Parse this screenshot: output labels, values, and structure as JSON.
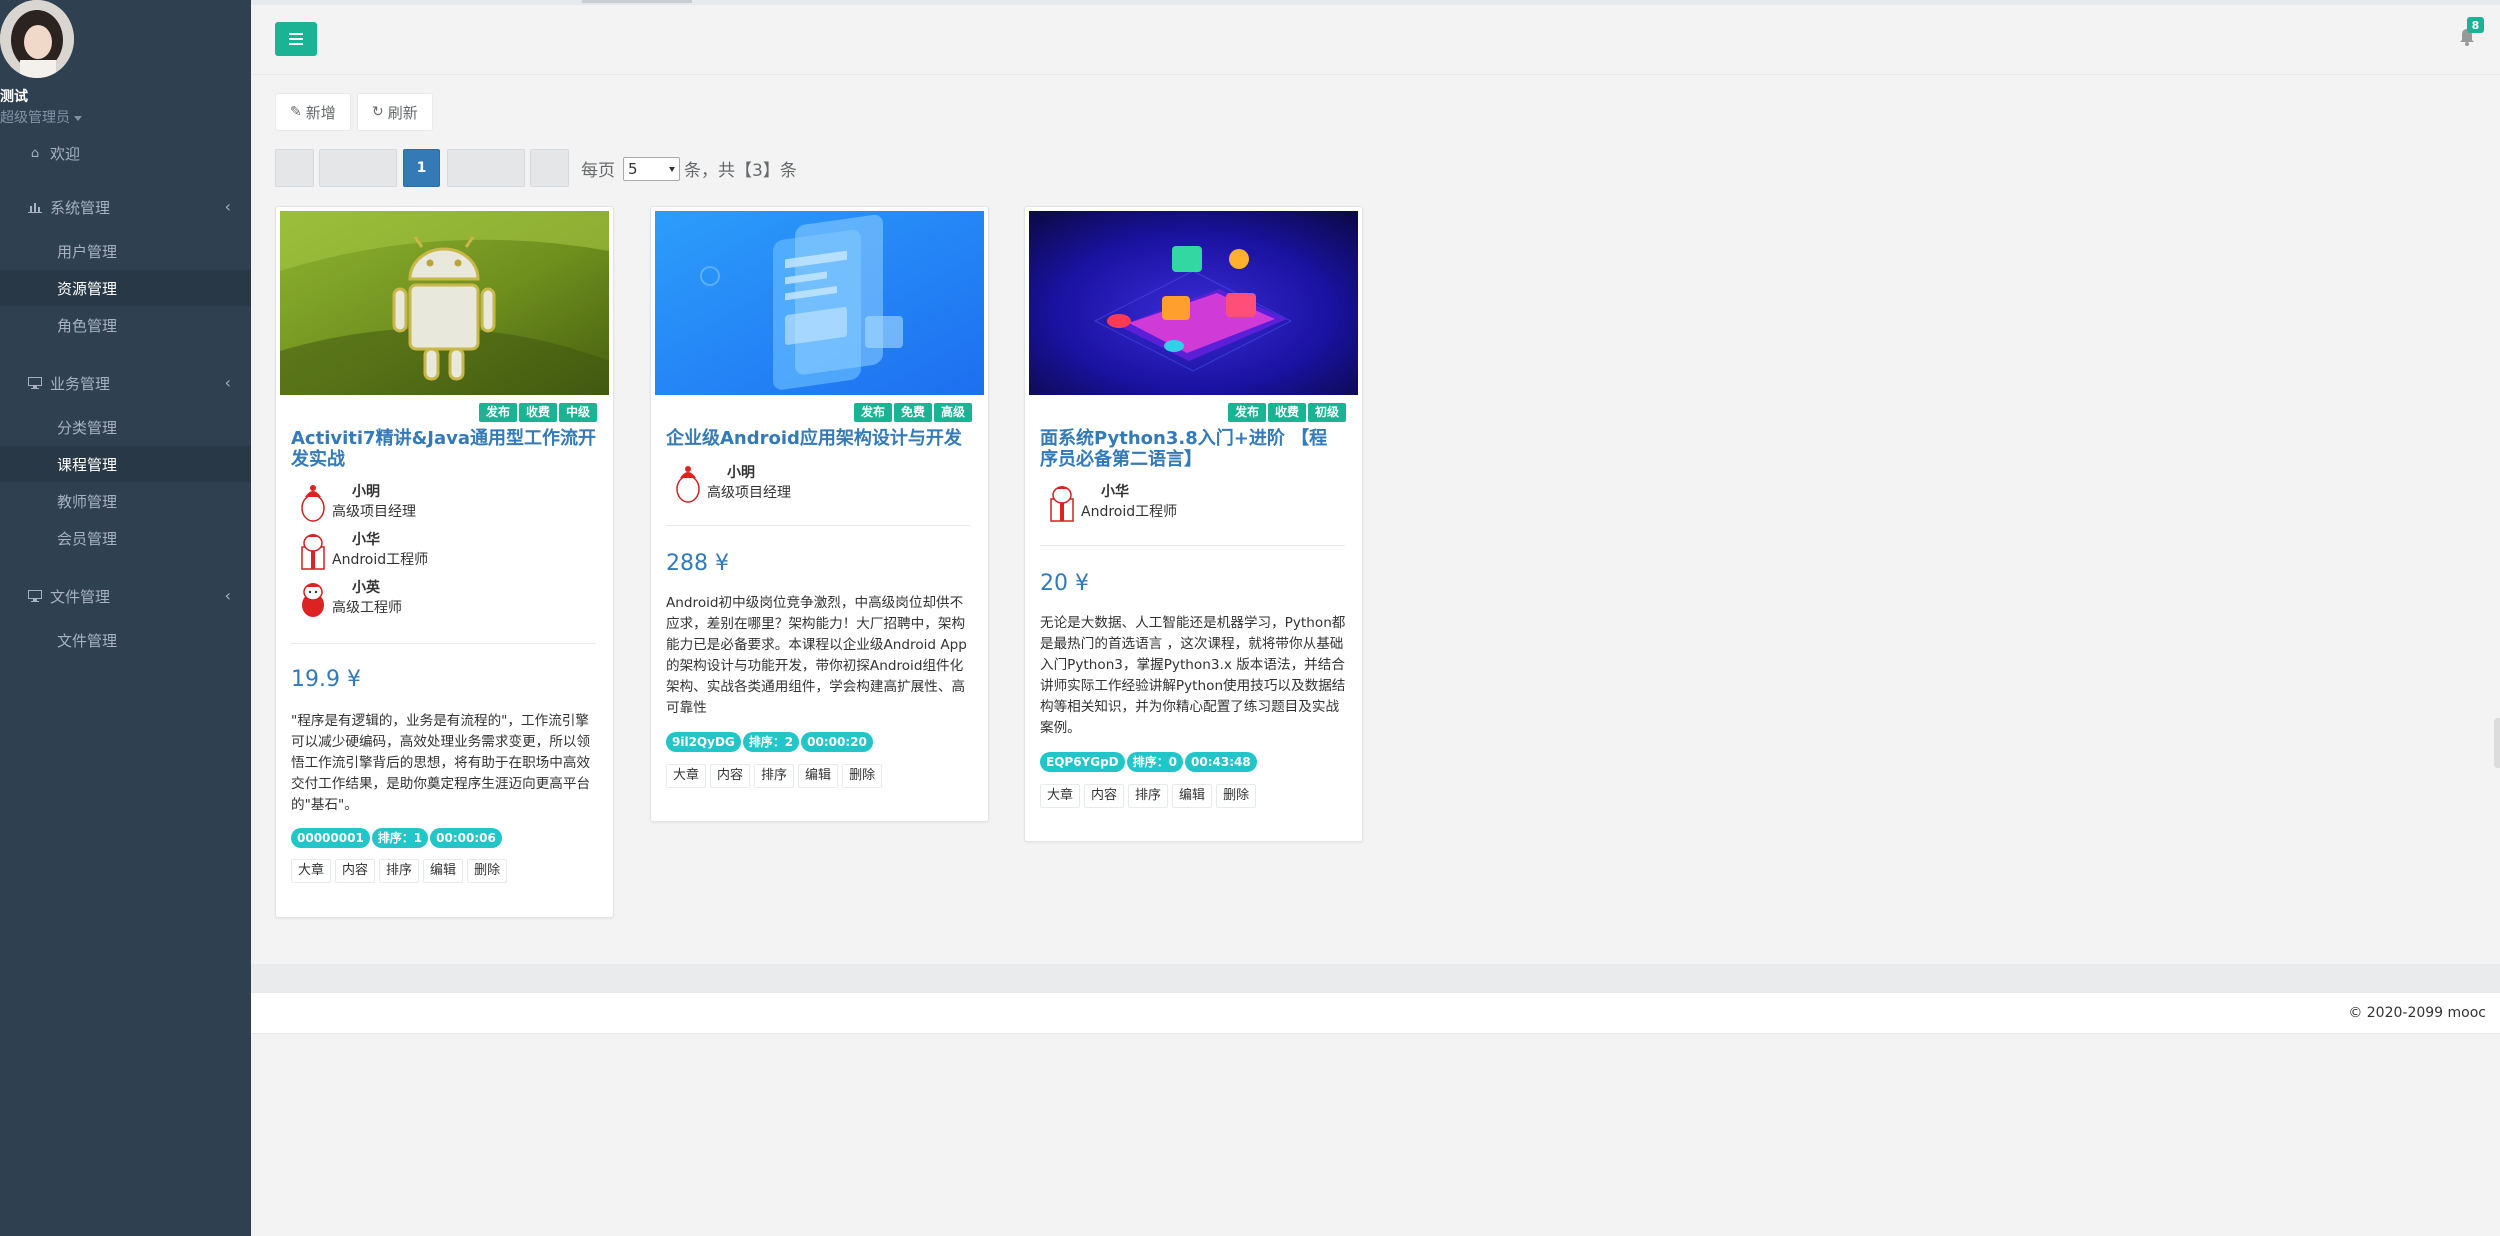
{
  "sidebar": {
    "user_name": "测试",
    "user_role": "超级管理员",
    "welcome": "欢迎",
    "groups": [
      {
        "label": "系统管理",
        "icon": "bar-chart-icon",
        "items": [
          {
            "label": "用户管理"
          },
          {
            "label": "资源管理"
          },
          {
            "label": "角色管理"
          }
        ]
      },
      {
        "label": "业务管理",
        "icon": "desktop-icon",
        "items": [
          {
            "label": "分类管理"
          },
          {
            "label": "课程管理"
          },
          {
            "label": "教师管理"
          },
          {
            "label": "会员管理"
          }
        ]
      },
      {
        "label": "文件管理",
        "icon": "desktop-icon",
        "items": [
          {
            "label": "文件管理"
          }
        ]
      }
    ],
    "active_items": [
      "资源管理",
      "课程管理"
    ]
  },
  "header": {
    "notification_count": "8"
  },
  "toolbar": {
    "add_label": "新增",
    "refresh_label": "刷新"
  },
  "pagination": {
    "current_page": "1",
    "per_page_prefix": "每页",
    "per_page_value": "5",
    "total_text": "条，共【3】条"
  },
  "courses": [
    {
      "title": "Activiti7精讲&Java通用型工作流开发实战",
      "tags": [
        "发布",
        "收费",
        "中级"
      ],
      "teachers": [
        {
          "name": "小明",
          "position": "高级项目经理"
        },
        {
          "name": "小华",
          "position": "Android工程师"
        },
        {
          "name": "小英",
          "position": "高级工程师"
        }
      ],
      "price": "19.9 ¥",
      "description": "\"程序是有逻辑的，业务是有流程的\"，工作流引擎可以减少硬编码，高效处理业务需求变更，所以领悟工作流引擎背后的思想，将有助于在职场中高效交付工作结果，是助你奠定程序生涯迈向更高平台的\"基石\"。",
      "badges": [
        "00000001",
        "排序：1",
        "00:00:06"
      ],
      "actions": [
        "大章",
        "内容",
        "排序",
        "编辑",
        "删除"
      ],
      "cover": "android-robot"
    },
    {
      "title": "企业级Android应用架构设计与开发",
      "tags": [
        "发布",
        "免费",
        "高级"
      ],
      "teachers": [
        {
          "name": "小明",
          "position": "高级项目经理"
        }
      ],
      "price": "288 ¥",
      "description": "Android初中级岗位竞争激烈，中高级岗位却供不应求，差别在哪里？架构能力！大厂招聘中，架构能力已是必备要求。本课程以企业级Android App的架构设计与功能开发，带你初探Android组件化架构、实战各类通用组件，学会构建高扩展性、高可靠性",
      "badges": [
        "9il2QyDG",
        "排序：2",
        "00:00:20"
      ],
      "actions": [
        "大章",
        "内容",
        "排序",
        "编辑",
        "删除"
      ],
      "cover": "blue-phone"
    },
    {
      "title": "面系统Python3.8入门+进阶 【程序员必备第二语言】",
      "tags": [
        "发布",
        "收费",
        "初级"
      ],
      "teachers": [
        {
          "name": "小华",
          "position": "Android工程师"
        }
      ],
      "price": "20 ¥",
      "description": "无论是大数据、人工智能还是机器学习，Python都是最热门的首选语言 ，这次课程，就将带你从基础入门Python3，掌握Python3.x 版本语法，并结合讲师实际工作经验讲解Python使用技巧以及数据结构等相关知识，并为你精心配置了练习题目及实战案例。",
      "badges": [
        "EQP6YGpD",
        "排序：0",
        "00:43:48"
      ],
      "actions": [
        "大章",
        "内容",
        "排序",
        "编辑",
        "删除"
      ],
      "cover": "isometric-phone"
    }
  ],
  "footer": {
    "copyright": "© 2020-2099 mooc"
  },
  "colors": {
    "sidebar_bg": "#2f4050",
    "accent_green": "#1ab394",
    "link_blue": "#337ab7",
    "badge_cyan": "#23c6c8"
  }
}
